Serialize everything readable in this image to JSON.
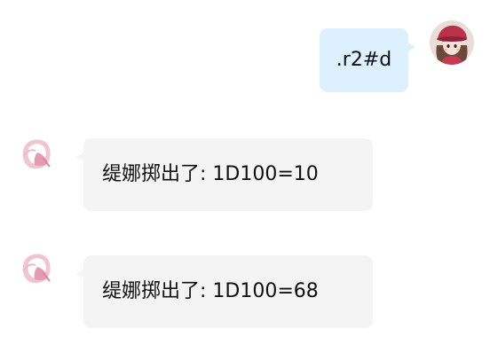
{
  "messages": [
    {
      "sender": "self",
      "avatar_icon": "user-avatar-icon",
      "text": ".r2#d",
      "bubble_color": "#ddf0fd"
    },
    {
      "sender": "bot",
      "avatar_icon": "bot-avatar-icon",
      "text": "缇娜掷出了: 1D100=10",
      "bubble_color": "#f4f4f5"
    },
    {
      "sender": "bot",
      "avatar_icon": "bot-avatar-icon",
      "text": "缇娜掷出了: 1D100=68",
      "bubble_color": "#f4f4f5"
    }
  ]
}
